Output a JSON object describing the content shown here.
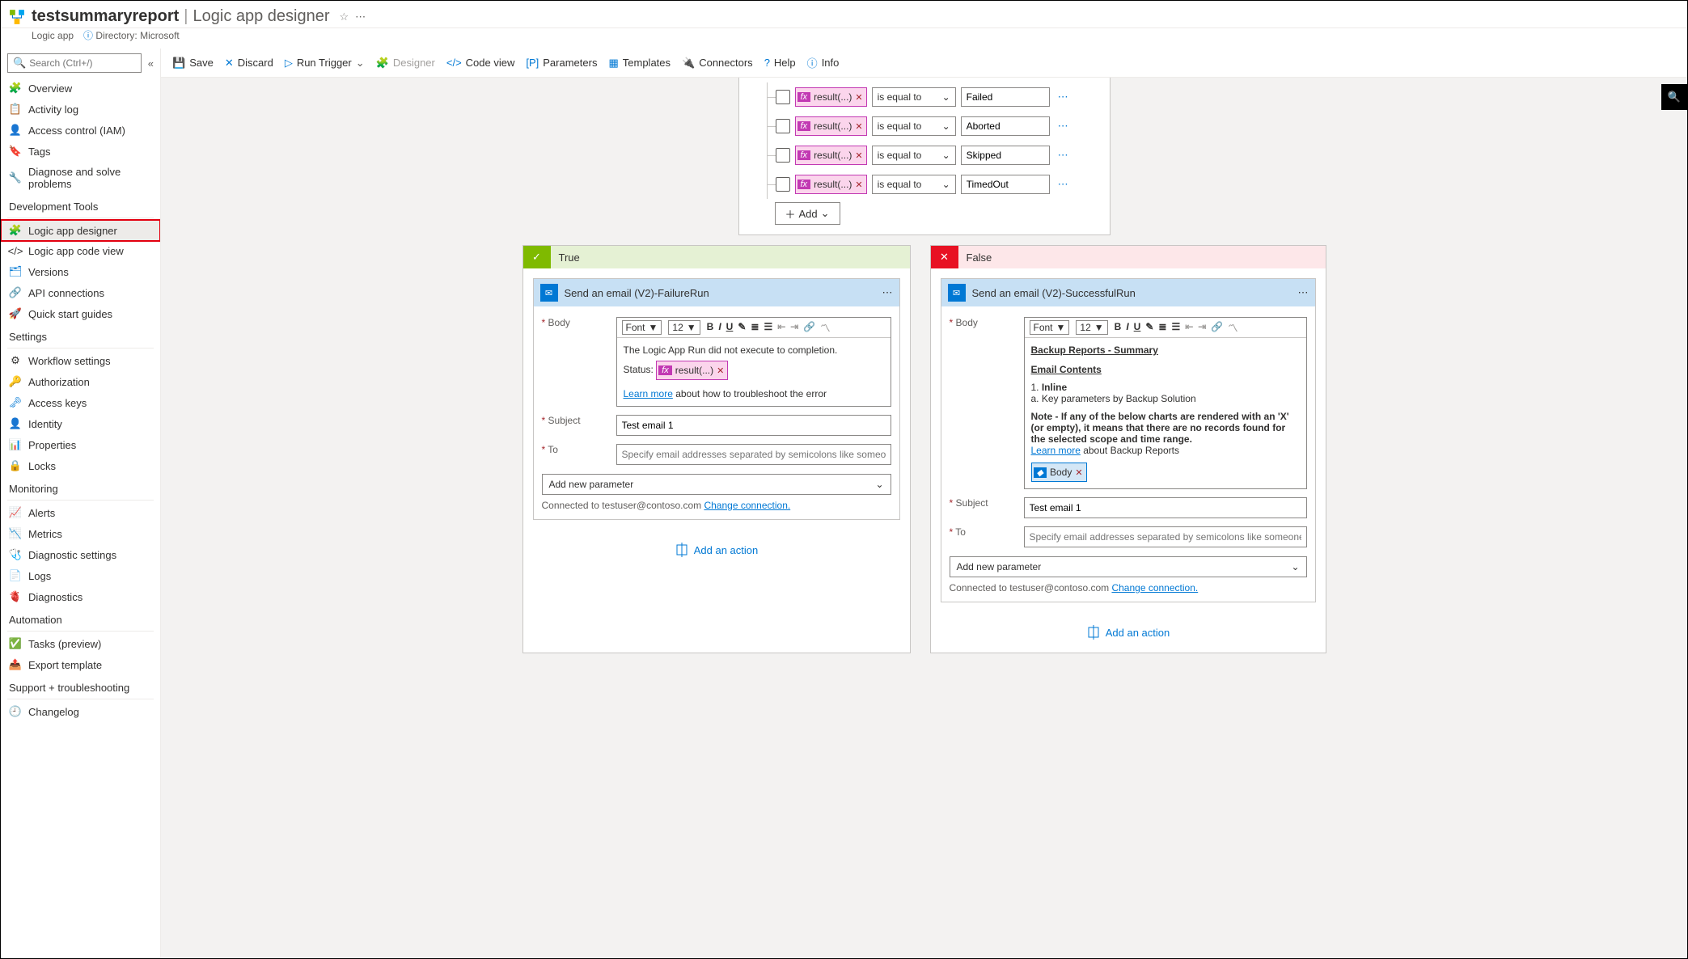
{
  "header": {
    "name": "testsummaryreport",
    "sep": "|",
    "blade": "Logic app designer",
    "sub": "Logic app",
    "directory": "Directory: Microsoft"
  },
  "search": {
    "placeholder": "Search (Ctrl+/)"
  },
  "nav": {
    "top": [
      {
        "label": "Overview"
      },
      {
        "label": "Activity log"
      },
      {
        "label": "Access control (IAM)"
      },
      {
        "label": "Tags"
      },
      {
        "label": "Diagnose and solve problems"
      }
    ],
    "sections": [
      {
        "title": "Development Tools",
        "items": [
          {
            "label": "Logic app designer",
            "active": true
          },
          {
            "label": "Logic app code view"
          },
          {
            "label": "Versions"
          },
          {
            "label": "API connections"
          },
          {
            "label": "Quick start guides"
          }
        ]
      },
      {
        "title": "Settings",
        "items": [
          {
            "label": "Workflow settings"
          },
          {
            "label": "Authorization"
          },
          {
            "label": "Access keys"
          },
          {
            "label": "Identity"
          },
          {
            "label": "Properties"
          },
          {
            "label": "Locks"
          }
        ]
      },
      {
        "title": "Monitoring",
        "items": [
          {
            "label": "Alerts"
          },
          {
            "label": "Metrics"
          },
          {
            "label": "Diagnostic settings"
          },
          {
            "label": "Logs"
          },
          {
            "label": "Diagnostics"
          }
        ]
      },
      {
        "title": "Automation",
        "items": [
          {
            "label": "Tasks (preview)"
          },
          {
            "label": "Export template"
          }
        ]
      },
      {
        "title": "Support + troubleshooting",
        "items": [
          {
            "label": "Changelog"
          }
        ]
      }
    ]
  },
  "toolbar": {
    "save": "Save",
    "discard": "Discard",
    "run": "Run Trigger",
    "designer": "Designer",
    "code": "Code view",
    "params": "Parameters",
    "templates": "Templates",
    "connectors": "Connectors",
    "help": "Help",
    "info": "Info"
  },
  "condition": {
    "rows": [
      {
        "token": "result(...)",
        "op": "is equal to",
        "val": "Failed"
      },
      {
        "token": "result(...)",
        "op": "is equal to",
        "val": "Aborted"
      },
      {
        "token": "result(...)",
        "op": "is equal to",
        "val": "Skipped"
      },
      {
        "token": "result(...)",
        "op": "is equal to",
        "val": "TimedOut"
      }
    ],
    "add": "Add"
  },
  "true_branch": {
    "title": "True",
    "action_title": "Send an email (V2)-FailureRun",
    "body_label": "Body",
    "font_label": "Font",
    "size": "12",
    "rte_text1": "The Logic App Run did not execute to completion.",
    "status_label": "Status:",
    "status_token": "result(...)",
    "learn": "Learn more",
    "learn_rest": " about how to troubleshoot the error",
    "subject_label": "Subject",
    "subject_val": "Test email 1",
    "to_label": "To",
    "to_placeholder": "Specify email addresses separated by semicolons like someone@contoso.com",
    "new_param": "Add new parameter",
    "conn": "Connected to testuser@contoso.com  ",
    "change": "Change connection.",
    "add_action": "Add an action"
  },
  "false_branch": {
    "title": "False",
    "action_title": "Send an email (V2)-SuccessfulRun",
    "body_label": "Body",
    "font_label": "Font",
    "size": "12",
    "h1": "Backup Reports - Summary",
    "h2": "Email Contents",
    "line1a": "1. ",
    "line1b": "Inline",
    "line2": "a. Key parameters by Backup Solution",
    "note": "Note - If any of the below charts are rendered with an 'X' (or empty), it means that there are no records found for the selected scope and time range.",
    "learn": "Learn more",
    "learn_rest": " about Backup Reports",
    "body_token": "Body",
    "subject_label": "Subject",
    "subject_val": "Test email 1",
    "to_label": "To",
    "to_placeholder": "Specify email addresses separated by semicolons like someone@contoso.com",
    "new_param": "Add new parameter",
    "conn": "Connected to testuser@contoso.com  ",
    "change": "Change connection.",
    "add_action": "Add an action"
  }
}
